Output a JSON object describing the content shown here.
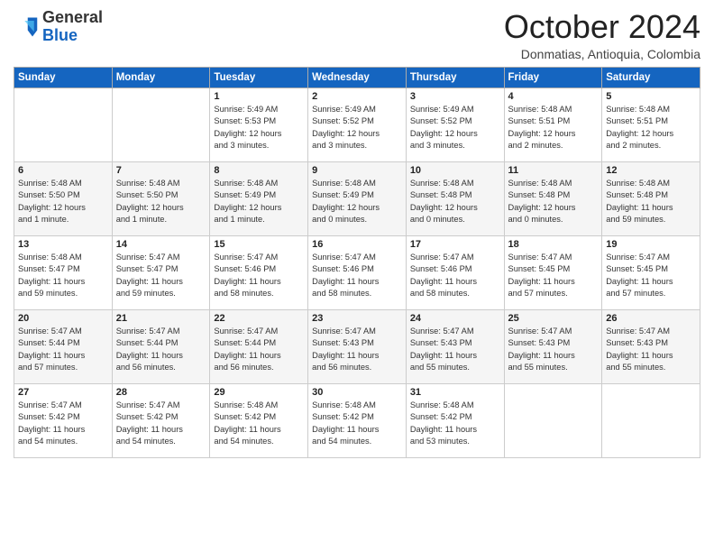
{
  "logo": {
    "general": "General",
    "blue": "Blue"
  },
  "header": {
    "month_title": "October 2024",
    "location": "Donmatias, Antioquia, Colombia"
  },
  "days_of_week": [
    "Sunday",
    "Monday",
    "Tuesday",
    "Wednesday",
    "Thursday",
    "Friday",
    "Saturday"
  ],
  "weeks": [
    [
      {
        "day": "",
        "info": ""
      },
      {
        "day": "",
        "info": ""
      },
      {
        "day": "1",
        "info": "Sunrise: 5:49 AM\nSunset: 5:53 PM\nDaylight: 12 hours\nand 3 minutes."
      },
      {
        "day": "2",
        "info": "Sunrise: 5:49 AM\nSunset: 5:52 PM\nDaylight: 12 hours\nand 3 minutes."
      },
      {
        "day": "3",
        "info": "Sunrise: 5:49 AM\nSunset: 5:52 PM\nDaylight: 12 hours\nand 3 minutes."
      },
      {
        "day": "4",
        "info": "Sunrise: 5:48 AM\nSunset: 5:51 PM\nDaylight: 12 hours\nand 2 minutes."
      },
      {
        "day": "5",
        "info": "Sunrise: 5:48 AM\nSunset: 5:51 PM\nDaylight: 12 hours\nand 2 minutes."
      }
    ],
    [
      {
        "day": "6",
        "info": "Sunrise: 5:48 AM\nSunset: 5:50 PM\nDaylight: 12 hours\nand 1 minute."
      },
      {
        "day": "7",
        "info": "Sunrise: 5:48 AM\nSunset: 5:50 PM\nDaylight: 12 hours\nand 1 minute."
      },
      {
        "day": "8",
        "info": "Sunrise: 5:48 AM\nSunset: 5:49 PM\nDaylight: 12 hours\nand 1 minute."
      },
      {
        "day": "9",
        "info": "Sunrise: 5:48 AM\nSunset: 5:49 PM\nDaylight: 12 hours\nand 0 minutes."
      },
      {
        "day": "10",
        "info": "Sunrise: 5:48 AM\nSunset: 5:48 PM\nDaylight: 12 hours\nand 0 minutes."
      },
      {
        "day": "11",
        "info": "Sunrise: 5:48 AM\nSunset: 5:48 PM\nDaylight: 12 hours\nand 0 minutes."
      },
      {
        "day": "12",
        "info": "Sunrise: 5:48 AM\nSunset: 5:48 PM\nDaylight: 11 hours\nand 59 minutes."
      }
    ],
    [
      {
        "day": "13",
        "info": "Sunrise: 5:48 AM\nSunset: 5:47 PM\nDaylight: 11 hours\nand 59 minutes."
      },
      {
        "day": "14",
        "info": "Sunrise: 5:47 AM\nSunset: 5:47 PM\nDaylight: 11 hours\nand 59 minutes."
      },
      {
        "day": "15",
        "info": "Sunrise: 5:47 AM\nSunset: 5:46 PM\nDaylight: 11 hours\nand 58 minutes."
      },
      {
        "day": "16",
        "info": "Sunrise: 5:47 AM\nSunset: 5:46 PM\nDaylight: 11 hours\nand 58 minutes."
      },
      {
        "day": "17",
        "info": "Sunrise: 5:47 AM\nSunset: 5:46 PM\nDaylight: 11 hours\nand 58 minutes."
      },
      {
        "day": "18",
        "info": "Sunrise: 5:47 AM\nSunset: 5:45 PM\nDaylight: 11 hours\nand 57 minutes."
      },
      {
        "day": "19",
        "info": "Sunrise: 5:47 AM\nSunset: 5:45 PM\nDaylight: 11 hours\nand 57 minutes."
      }
    ],
    [
      {
        "day": "20",
        "info": "Sunrise: 5:47 AM\nSunset: 5:44 PM\nDaylight: 11 hours\nand 57 minutes."
      },
      {
        "day": "21",
        "info": "Sunrise: 5:47 AM\nSunset: 5:44 PM\nDaylight: 11 hours\nand 56 minutes."
      },
      {
        "day": "22",
        "info": "Sunrise: 5:47 AM\nSunset: 5:44 PM\nDaylight: 11 hours\nand 56 minutes."
      },
      {
        "day": "23",
        "info": "Sunrise: 5:47 AM\nSunset: 5:43 PM\nDaylight: 11 hours\nand 56 minutes."
      },
      {
        "day": "24",
        "info": "Sunrise: 5:47 AM\nSunset: 5:43 PM\nDaylight: 11 hours\nand 55 minutes."
      },
      {
        "day": "25",
        "info": "Sunrise: 5:47 AM\nSunset: 5:43 PM\nDaylight: 11 hours\nand 55 minutes."
      },
      {
        "day": "26",
        "info": "Sunrise: 5:47 AM\nSunset: 5:43 PM\nDaylight: 11 hours\nand 55 minutes."
      }
    ],
    [
      {
        "day": "27",
        "info": "Sunrise: 5:47 AM\nSunset: 5:42 PM\nDaylight: 11 hours\nand 54 minutes."
      },
      {
        "day": "28",
        "info": "Sunrise: 5:47 AM\nSunset: 5:42 PM\nDaylight: 11 hours\nand 54 minutes."
      },
      {
        "day": "29",
        "info": "Sunrise: 5:48 AM\nSunset: 5:42 PM\nDaylight: 11 hours\nand 54 minutes."
      },
      {
        "day": "30",
        "info": "Sunrise: 5:48 AM\nSunset: 5:42 PM\nDaylight: 11 hours\nand 54 minutes."
      },
      {
        "day": "31",
        "info": "Sunrise: 5:48 AM\nSunset: 5:42 PM\nDaylight: 11 hours\nand 53 minutes."
      },
      {
        "day": "",
        "info": ""
      },
      {
        "day": "",
        "info": ""
      }
    ]
  ]
}
